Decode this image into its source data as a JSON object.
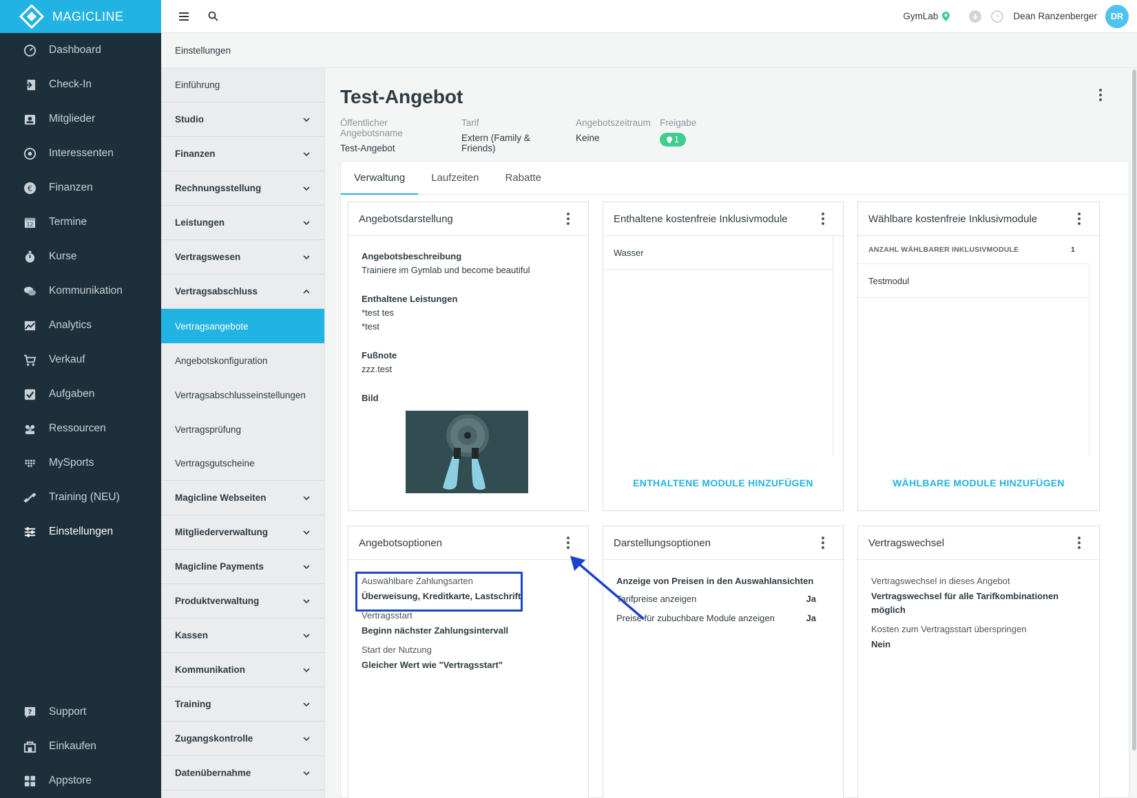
{
  "brand": {
    "name": "MAGICLINE"
  },
  "nav": {
    "items": [
      {
        "label": "Dashboard"
      },
      {
        "label": "Check-In"
      },
      {
        "label": "Mitglieder"
      },
      {
        "label": "Interessenten"
      },
      {
        "label": "Finanzen"
      },
      {
        "label": "Termine"
      },
      {
        "label": "Kurse"
      },
      {
        "label": "Kommunikation"
      },
      {
        "label": "Analytics"
      },
      {
        "label": "Verkauf"
      },
      {
        "label": "Aufgaben"
      },
      {
        "label": "Ressourcen"
      },
      {
        "label": "MySports"
      },
      {
        "label": "Training (NEU)"
      },
      {
        "label": "Einstellungen"
      }
    ],
    "bottom": [
      {
        "label": "Support"
      },
      {
        "label": "Einkaufen"
      },
      {
        "label": "Appstore"
      }
    ]
  },
  "topbar": {
    "studio": "GymLab",
    "user": "Dean Ranzenberger",
    "initials": "DR"
  },
  "breadcrumb": "Einstellungen",
  "subnav": {
    "items": [
      {
        "label": "Einführung"
      },
      {
        "label": "Studio"
      },
      {
        "label": "Finanzen"
      },
      {
        "label": "Rechnungsstellung"
      },
      {
        "label": "Leistungen"
      },
      {
        "label": "Vertragswesen"
      },
      {
        "label": "Vertragsabschluss"
      },
      {
        "label": "Vertragsangebote"
      },
      {
        "label": "Angebotskonfiguration"
      },
      {
        "label": "Vertragsabschlusseinstellungen"
      },
      {
        "label": "Vertragsprüfung"
      },
      {
        "label": "Vertragsgutscheine"
      },
      {
        "label": "Magicline Webseiten"
      },
      {
        "label": "Mitgliederverwaltung"
      },
      {
        "label": "Magicline Payments"
      },
      {
        "label": "Produktverwaltung"
      },
      {
        "label": "Kassen"
      },
      {
        "label": "Kommunikation"
      },
      {
        "label": "Training"
      },
      {
        "label": "Zugangskontrolle"
      },
      {
        "label": "Datenübernahme"
      }
    ]
  },
  "page": {
    "title": "Test-Angebot",
    "meta": [
      {
        "label": "Öffentlicher Angebotsname",
        "value": "Test-Angebot"
      },
      {
        "label": "Tarif",
        "value": "Extern (Family & Friends)"
      },
      {
        "label": "Angebotszeitraum",
        "value": "Keine"
      },
      {
        "label": "Freigabe",
        "value": "1"
      }
    ],
    "tabs": [
      {
        "label": "Verwaltung"
      },
      {
        "label": "Laufzeiten"
      },
      {
        "label": "Rabatte"
      }
    ]
  },
  "cards": {
    "darstellung": {
      "title": "Angebotsdarstellung",
      "desc_label": "Angebotsbeschreibung",
      "desc_value": "Trainiere im Gymlab und become beautiful",
      "services_label": "Enthaltene Leistungen",
      "services": [
        "*test tes",
        "*test"
      ],
      "footnote_label": "Fußnote",
      "footnote_value": "zzz.test",
      "image_label": "Bild"
    },
    "enthaltene": {
      "title": "Enthaltene kostenfreie Inklusivmodule",
      "items": [
        "Wasser"
      ],
      "action": "ENTHALTENE MODULE HINZUFÜGEN"
    },
    "waehlbare": {
      "title": "Wählbare kostenfreie Inklusivmodule",
      "count_label": "ANZAHL WÄHLBARER INKLUSIVMODULE",
      "count_value": "1",
      "items": [
        "Testmodul"
      ],
      "action": "WÄHLBARE MODULE HINZUFÜGEN"
    },
    "optionen": {
      "title": "Angebotsoptionen",
      "options": [
        {
          "label": "Auswählbare Zahlungsarten",
          "value": "Überweisung, Kreditkarte, Lastschrift"
        },
        {
          "label": "Vertragsstart",
          "value": "Beginn nächster Zahlungsintervall"
        },
        {
          "label": "Start der Nutzung",
          "value": "Gleicher Wert wie \"Vertragsstart\""
        }
      ]
    },
    "darstellungsoptionen": {
      "title": "Darstellungsoptionen",
      "heading": "Anzeige von Preisen in den Auswahlansichten",
      "rows": [
        {
          "label": "Tarifpreise anzeigen",
          "value": "Ja"
        },
        {
          "label": "Preise für zubuchbare Module anzeigen",
          "value": "Ja"
        }
      ]
    },
    "wechsel": {
      "title": "Vertragswechsel",
      "label1": "Vertragswechsel in dieses Angebot",
      "value1": "Vertragswechsel für alle Tarifkombinationen möglich",
      "label2": "Kosten zum Vertragsstart überspringen",
      "value2": "Nein"
    }
  },
  "colors": {
    "accent": "#20b3e4",
    "sidebar": "#1d2f3a",
    "badge": "#3ccf8e",
    "annotation": "#1c43c9"
  }
}
